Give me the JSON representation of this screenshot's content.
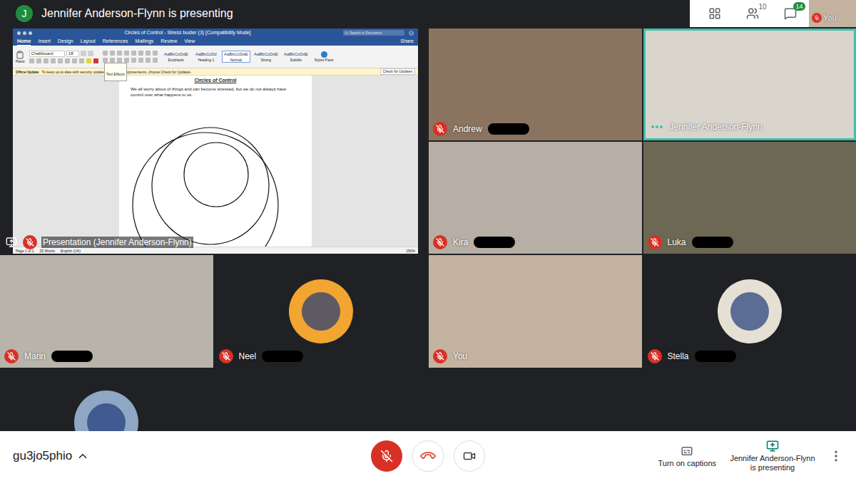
{
  "presenter_banner": {
    "initial": "J",
    "text": "Jennifer Anderson-Flynn is presenting"
  },
  "toolbar": {
    "people_count": "10",
    "chat_count": "14",
    "self_label": "You",
    "self_muted": true
  },
  "presentation": {
    "label": "Presentation (Jennifer Anderson-Flynn)",
    "muted": true,
    "document": {
      "title": "Circles of Control - Stress buster (3) [Compatibility Mode]",
      "search_placeholder": "Search in Document",
      "share": "Share",
      "tabs": [
        {
          "label": "Home",
          "selected": true
        },
        {
          "label": "Insert",
          "selected": false
        },
        {
          "label": "Design",
          "selected": false
        },
        {
          "label": "Layout",
          "selected": false
        },
        {
          "label": "References",
          "selected": false
        },
        {
          "label": "Mailings",
          "selected": false
        },
        {
          "label": "Review",
          "selected": false
        },
        {
          "label": "View",
          "selected": false
        }
      ],
      "paste": "Paste",
      "font": "Chalkboard",
      "size": "18",
      "tooltip": "Text Effects",
      "styles": [
        {
          "preview": "AaBbCcDdE",
          "name": "Emphasis",
          "selected": false
        },
        {
          "preview": "AaBbCcDd",
          "name": "Heading 1",
          "selected": false
        },
        {
          "preview": "AaBbCcDdE",
          "name": "Normal",
          "selected": true
        },
        {
          "preview": "AaBbCcDdE",
          "name": "Strong",
          "selected": false
        },
        {
          "preview": "AaBbCcDdE",
          "name": "Subtitle",
          "selected": false
        }
      ],
      "styles_pane": "Styles Pane",
      "update": {
        "title": "Office Update",
        "message": "To keep up-to-date with security updates, fixes, and improvements, choose Check for Updates.",
        "button": "Check for Updates"
      },
      "heading": "Circles of Control",
      "body": "We all worry about of things and can become stressed, but we do not always have control over what happens to us.",
      "status": {
        "page": "Page 1 of 1",
        "words": "25 Words",
        "language": "English (UK)",
        "zoom": "150%"
      }
    }
  },
  "tiles": [
    {
      "name": "Andrew",
      "kind": "video",
      "muted": true,
      "speaking": false,
      "redacted": true,
      "color": "#8a7460"
    },
    {
      "name": "Jennifer Anderson-Flynn",
      "kind": "video",
      "muted": false,
      "speaking": true,
      "redacted": false,
      "color": "#d9d5cd"
    },
    {
      "name": "Kira",
      "kind": "video",
      "muted": true,
      "speaking": false,
      "redacted": true,
      "color": "#b7afa6"
    },
    {
      "name": "Luka",
      "kind": "video",
      "muted": true,
      "speaking": false,
      "redacted": true,
      "color": "#6d6853"
    },
    {
      "name": "Marin",
      "kind": "video",
      "muted": true,
      "speaking": false,
      "redacted": true,
      "color": "#b8b4ab"
    },
    {
      "name": "Neel",
      "kind": "avatar",
      "muted": true,
      "speaking": false,
      "redacted": true,
      "color": "#f2a531"
    },
    {
      "name": "You",
      "kind": "video",
      "muted": true,
      "speaking": false,
      "redacted": false,
      "color": "#c4b39f"
    },
    {
      "name": "Stella",
      "kind": "avatar",
      "muted": true,
      "speaking": false,
      "redacted": true,
      "color": "#e6e0d4"
    },
    {
      "kind": "avatar",
      "muted": false,
      "speaking": false,
      "redacted": false,
      "color": "#8fa7c4"
    }
  ],
  "bottom_bar": {
    "meeting_code": "gu3jo5phio",
    "mic_muted": true,
    "captions": "Turn on captions",
    "presenting": "Jennifer Anderson-Flynn is presenting"
  }
}
